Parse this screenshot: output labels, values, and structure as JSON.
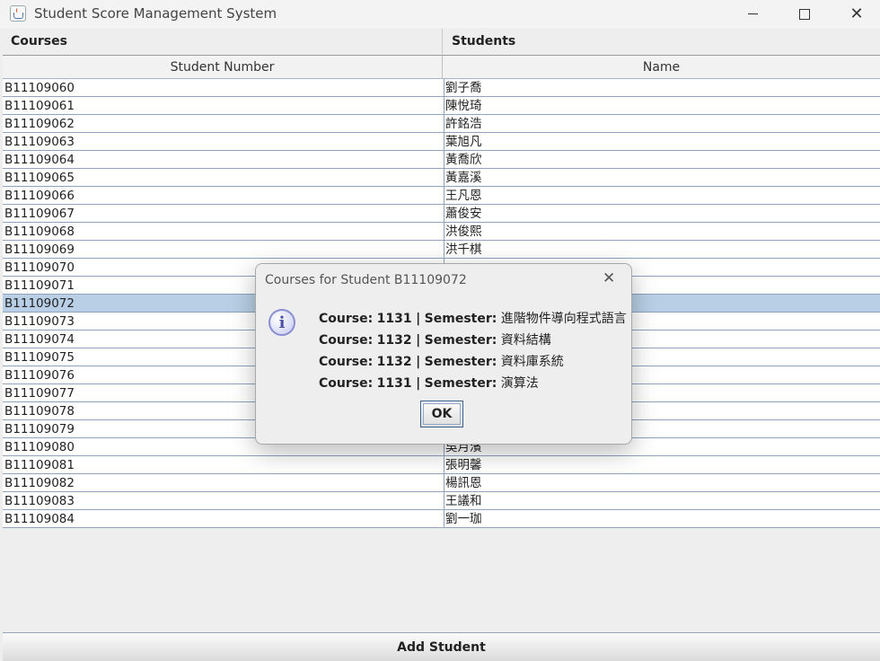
{
  "window": {
    "title": "Student Score Management System",
    "icon": "java-cup-icon"
  },
  "tabs": {
    "courses": "Courses",
    "students": "Students"
  },
  "table": {
    "columns": [
      "Student Number",
      "Name"
    ],
    "selected_row": "B11109072",
    "rows": [
      {
        "num": "B11109060",
        "name": "劉子喬"
      },
      {
        "num": "B11109061",
        "name": "陳悅琦"
      },
      {
        "num": "B11109062",
        "name": "許銘浩"
      },
      {
        "num": "B11109063",
        "name": "葉旭凡"
      },
      {
        "num": "B11109064",
        "name": "黃喬欣"
      },
      {
        "num": "B11109065",
        "name": "黃嘉溪"
      },
      {
        "num": "B11109066",
        "name": "王凡恩"
      },
      {
        "num": "B11109067",
        "name": "蕭俊安"
      },
      {
        "num": "B11109068",
        "name": "洪俊熙"
      },
      {
        "num": "B11109069",
        "name": "洪千棋"
      },
      {
        "num": "B11109070",
        "name": ""
      },
      {
        "num": "B11109071",
        "name": ""
      },
      {
        "num": "B11109072",
        "name": ""
      },
      {
        "num": "B11109073",
        "name": ""
      },
      {
        "num": "B11109074",
        "name": ""
      },
      {
        "num": "B11109075",
        "name": ""
      },
      {
        "num": "B11109076",
        "name": ""
      },
      {
        "num": "B11109077",
        "name": ""
      },
      {
        "num": "B11109078",
        "name": ""
      },
      {
        "num": "B11109079",
        "name": ""
      },
      {
        "num": "B11109080",
        "name": "吳月濱"
      },
      {
        "num": "B11109081",
        "name": "張明馨"
      },
      {
        "num": "B11109082",
        "name": "楊訊恩"
      },
      {
        "num": "B11109083",
        "name": "王議和"
      },
      {
        "num": "B11109084",
        "name": "劉一珈"
      }
    ]
  },
  "add_button": "Add Student",
  "dialog": {
    "title": "Courses for Student B11109072",
    "icon": "info-icon",
    "icon_glyph": "i",
    "course_label": "Course:",
    "semester_label": "Semester:",
    "separator": "|",
    "lines": [
      {
        "course": "1131",
        "semester": "進階物件導向程式語言"
      },
      {
        "course": "1132",
        "semester": "資料結構"
      },
      {
        "course": "1132",
        "semester": "資料庫系統"
      },
      {
        "course": "1131",
        "semester": "演算法"
      }
    ],
    "ok": "OK"
  }
}
